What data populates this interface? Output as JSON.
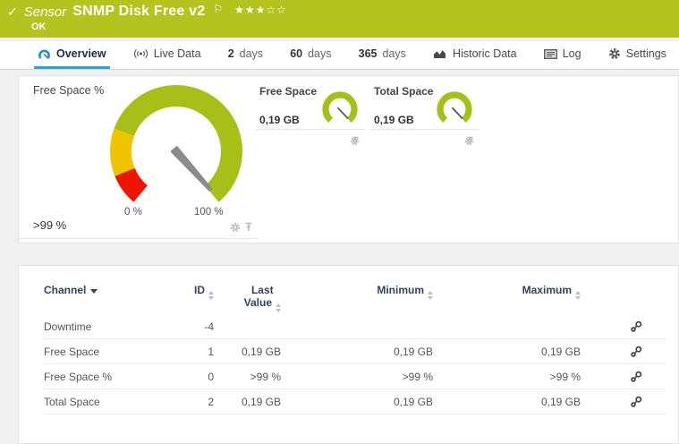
{
  "colors": {
    "header_green": "#b5c31e",
    "gauge_green": "#a6c018",
    "gauge_yellow": "#f0c500",
    "gauge_red": "#ee1400",
    "needle_gray": "#8c8c8c",
    "active_tab_blue": "#2aa3d6",
    "table_header_navy": "#33415e"
  },
  "header": {
    "check_icon": "✓",
    "kind_label": "Sensor",
    "title": "SNMP Disk Free v2",
    "flag_icon": "⚐",
    "stars_filled": "★★★",
    "stars_empty": "☆☆",
    "status": "OK"
  },
  "tabs": [
    {
      "label": "Overview",
      "icon": "gauge-icon",
      "active": true
    },
    {
      "label": "Live Data",
      "icon": "live-icon"
    },
    {
      "prefix": "2",
      "label": "days"
    },
    {
      "prefix": "60",
      "label": "days"
    },
    {
      "prefix": "365",
      "label": "days"
    },
    {
      "label": "Historic Data",
      "icon": "area-chart-icon"
    },
    {
      "label": "Log",
      "icon": "log-icon"
    },
    {
      "label": "Settings",
      "icon": "gear-icon"
    }
  ],
  "gauges": {
    "main": {
      "title": "Free Space %",
      "value": ">99 %",
      "min_label": "0 %",
      "max_label": "100 %",
      "icons": [
        "gear-icon",
        "pin-icon"
      ]
    },
    "small": [
      {
        "title": "Free Space",
        "value": "0,19 GB",
        "icons": [
          "gear-icon",
          "pin-icon"
        ]
      },
      {
        "title": "Total Space",
        "value": "0,19 GB",
        "icons": [
          "gear-icon",
          "pin-icon"
        ]
      }
    ]
  },
  "table": {
    "columns": {
      "channel": "Channel",
      "id": "ID",
      "last_line1": "Last",
      "last_line2": "Value",
      "min": "Minimum",
      "max": "Maximum"
    },
    "row_action_icon": "wrench-icon",
    "rows": [
      {
        "channel": "Downtime",
        "id": "-4",
        "last": "",
        "min": "",
        "max": ""
      },
      {
        "channel": "Free Space",
        "id": "1",
        "last": "0,19 GB",
        "min": "0,19 GB",
        "max": "0,19 GB"
      },
      {
        "channel": "Free Space %",
        "id": "0",
        "last": ">99 %",
        "min": ">99 %",
        "max": ">99 %"
      },
      {
        "channel": "Total Space",
        "id": "2",
        "last": "0,19 GB",
        "min": "0,19 GB",
        "max": "0,19 GB"
      }
    ]
  }
}
